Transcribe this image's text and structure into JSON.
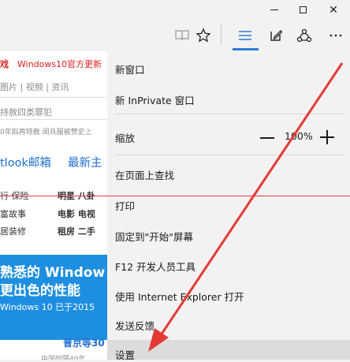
{
  "window": {
    "minimize_icon": "minimize-icon",
    "maximize_icon": "maximize-icon",
    "close_glyph": "✕"
  },
  "toolbar": {
    "icons": [
      "reading-view-icon",
      "favorite-star-icon",
      "hub-icon",
      "web-note-icon",
      "share-icon",
      "more-icon"
    ],
    "accent_color": "#2e7bd6"
  },
  "background_page": {
    "line1_left": "戏",
    "line1_right": "Windows10官方更新",
    "nav": "图片 | 视频 | 资讯",
    "headline1": "持赦四类罪犯",
    "headline2": "0年拟再特赦   阅兵服被赞史上",
    "mail_link": "tlook邮箱",
    "mail_right": "最新主",
    "grid_r1_left": "行  保险",
    "grid_r1_right": "明星  八卦",
    "grid_r2_left": "富故事",
    "grid_r2_right": "电影  电视",
    "grid_r3_left": "居装修",
    "grid_r3_right": "租房  二手",
    "banner_line1": "熟悉的 Window",
    "banner_line2": "更出色的性能",
    "banner_line3": "Windows 10 已于2015",
    "bottom_text": "普京等30",
    "bottom_sub": "中国时隔40年"
  },
  "menu": {
    "items": [
      {
        "label": "新窗口"
      },
      {
        "label": "新 InPrivate 窗口"
      },
      {
        "label": "缩放"
      },
      {
        "label": "在页面上查找"
      },
      {
        "label": "打印"
      },
      {
        "label": "固定到\"开始\"屏幕"
      },
      {
        "label": "F12 开发人员工具"
      },
      {
        "label": "使用 Internet Explorer 打开"
      },
      {
        "label": "发送反馈"
      },
      {
        "label": "设置"
      }
    ],
    "zoom_value": "100%",
    "highlight_color": "#dcdcdc"
  },
  "annotation": {
    "arrow_color": "#e53935"
  }
}
